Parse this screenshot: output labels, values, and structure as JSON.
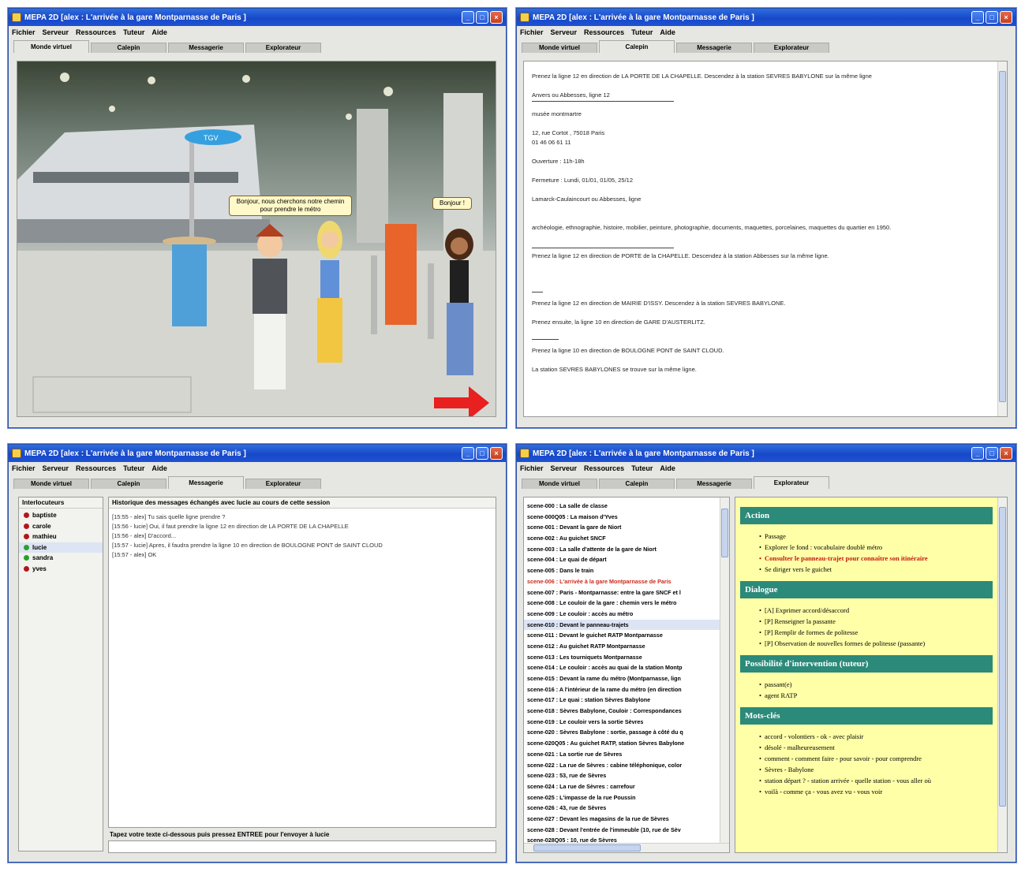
{
  "window_title": "MEPA 2D [alex : L'arrivée à la gare Montparnasse de Paris ]",
  "menu": [
    "Fichier",
    "Serveur",
    "Ressources",
    "Tuteur",
    "Aide"
  ],
  "tabs": [
    "Monde virtuel",
    "Calepin",
    "Messagerie",
    "Explorateur"
  ],
  "world": {
    "bubble_1": "Bonjour, nous cherchons notre chemin pour prendre le métro",
    "bubble_2": "Bonjour !",
    "sign": "TGV"
  },
  "notes": {
    "lines": [
      "Prenez la ligne 12 en direction de LA PORTE DE LA CHAPELLE. Descendez à la station SEVRES BABYLONE sur la même ligne",
      "Anvers ou Abbesses, ligne 12",
      "musée montmartre",
      "12, rue Cortot , 75018 Paris",
      "01 46 06 61 11",
      "Ouverture : 11h-18h",
      "Fermeture : Lundi, 01/01, 01/05, 25/12",
      "Lamarck-Caulaincourt ou Abbesses, ligne",
      "archéologie, ethnographie, histoire, mobilier, peinture, photographie, documents, maquettes, porcelaines, maquettes du quartier en 1950.",
      "Prenez la ligne 12 en direction de PORTE de la CHAPELLE. Descendez à la station Abbesses sur la même ligne.",
      "Prenez la ligne 12 en direction de MAIRIE D'ISSY. Descendez à la station SEVRES BABYLONE.",
      "Prenez ensuite, la ligne 10 en direction de GARE D'AUSTERLITZ.",
      "Prenez la ligne 10 en direction de BOULOGNE PONT de SAINT CLOUD.",
      "La station SEVRES BABYLONES se trouve sur la même ligne."
    ]
  },
  "messaging": {
    "interlocutors_header": "Interlocuteurs",
    "history_header": "Historique des messages échangés avec lucie au cours de cette session",
    "interlocutors": [
      {
        "name": "baptiste",
        "status_color": "#b01818"
      },
      {
        "name": "carole",
        "status_color": "#b01818"
      },
      {
        "name": "mathieu",
        "status_color": "#b01818"
      },
      {
        "name": "lucie",
        "status_color": "#2aa02a"
      },
      {
        "name": "sandra",
        "status_color": "#2aa02a"
      },
      {
        "name": "yves",
        "status_color": "#b01818"
      }
    ],
    "messages": [
      "[15:55 - alex] Tu sais quelle ligne prendre ?",
      "[15:56 - lucie] Oui, il faut prendre la ligne 12 en direction de LA PORTE DE LA CHAPELLE",
      "[15:56 - alex] D'accord...",
      "[15:57 - lucie] Apres, il faudra prendre la ligne 10 en direction de BOULOGNE PONT de SAINT CLOUD",
      "[15:57 - alex] OK"
    ],
    "input_label": "Tapez votre texte ci-dessous puis pressez ENTREE pour l'envoyer à lucie"
  },
  "explorer": {
    "scenes": [
      "scene-000 : La salle de classe",
      "scene-000Q05 : La maison d'Yves",
      "scene-001 : Devant la gare de Niort",
      "scene-002 : Au guichet SNCF",
      "scene-003 : La salle d'attente de la gare de Niort",
      "scene-004 : Le quai de départ",
      "scene-005 : Dans le train",
      "scene-006 : L'arrivée à la gare Montparnasse de Paris",
      "scene-007 : Paris - Montparnasse: entre la gare SNCF et l",
      "scene-008 : Le couloir de la gare : chemin vers le métro",
      "scene-009 : Le couloir : accès au métro",
      "scene-010 : Devant le panneau-trajets",
      "scene-011 : Devant le guichet RATP Montparnasse",
      "scene-012 : Au guichet RATP Montparnasse",
      "scene-013 : Les tourniquets Montparnasse",
      "scene-014 : Le couloir : accès au quai de la station Montp",
      "scene-015 : Devant la rame du métro (Montparnasse, lign",
      "scene-016 : A l'intérieur de la rame du métro (en direction",
      "scene-017 : Le quai : station Sèvres Babylone",
      "scene-018 : Sèvres Babylone, Couloir : Correspondances",
      "scene-019 : Le couloir vers la sortie Sèvres",
      "scene-020 : Sèvres Babylone : sortie, passage à côté du q",
      "scene-020Q05 : Au guichet RATP, station Sèvres Babylone",
      "scene-021 : La sortie rue de Sèvres",
      "scene-022 : La rue de Sèvres : cabine téléphonique, color",
      "scene-023 : 53, rue de Sèvres",
      "scene-024 : La rue de Sèvres : carrefour",
      "scene-025 : L'impasse de la rue Poussin",
      "scene-026 : 43, rue de Sèvres",
      "scene-027 : Devant les magasins de la rue de Sèvres",
      "scene-028 : Devant l'entrée de l'immeuble (10, rue de Sèv",
      "scene-028Q05 : 10, rue de Sèvres"
    ],
    "selected_index": 11,
    "highlight_index": 7,
    "sections": [
      {
        "title": "Action",
        "items": [
          "Passage",
          "Explorer le fond : vocabulaire doublé métro",
          "Consulter le panneau-trajet pour connaître son itinéraire",
          "Se diriger vers le guichet"
        ],
        "highlight": 2
      },
      {
        "title": "Dialogue",
        "items": [
          "[A] Exprimer accord/désaccord",
          "[P] Renseigner la passante",
          "[P] Remplir de formes de politesse",
          "[P] Observation de nouvelles formes de politesse (passante)"
        ],
        "highlight": -1
      },
      {
        "title": "Possibilité d'intervention (tuteur)",
        "items": [
          "passant(e)",
          "agent RATP"
        ],
        "highlight": -1
      },
      {
        "title": "Mots-clés",
        "items": [
          "accord - volontiers - ok - avec plaisir",
          "désolé - malheureusement",
          "comment - comment faire - pour savoir - pour comprendre",
          "Sèvres - Babylone",
          "station départ ? - station arrivée - quelle station - vous aller où",
          "voilà - comme ça - vous avez vu - vous voir"
        ],
        "highlight": -1
      }
    ]
  },
  "colors": {
    "titlebar": "#1f55d6",
    "section_head": "#2b8a7a",
    "info_bg": "#ffffa8",
    "highlight_text": "#c41a10"
  }
}
